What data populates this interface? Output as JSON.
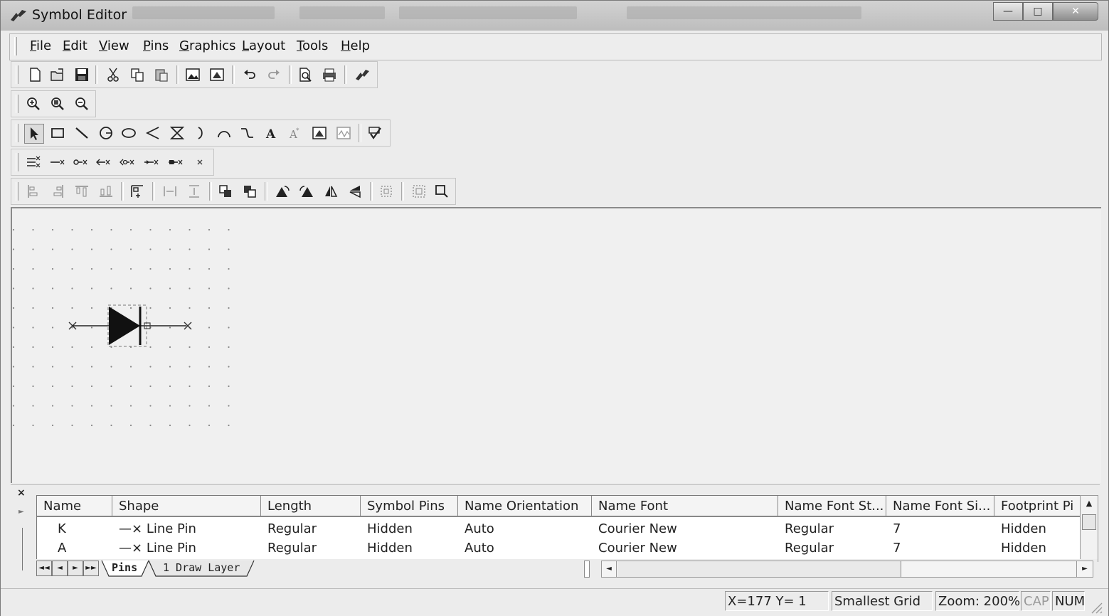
{
  "window": {
    "title": "Symbol Editor",
    "controls": [
      "minimize",
      "maximize",
      "close"
    ]
  },
  "menubar": {
    "items": [
      {
        "label": "File",
        "mnemonic": "F",
        "rest": "ile"
      },
      {
        "label": "Edit",
        "mnemonic": "E",
        "rest": "dit"
      },
      {
        "label": "View",
        "mnemonic": "V",
        "rest": "iew"
      },
      {
        "label": "Pins",
        "mnemonic": "P",
        "rest": "ins"
      },
      {
        "label": "Graphics",
        "mnemonic": "G",
        "rest": "raphics"
      },
      {
        "label": "Layout",
        "mnemonic": "L",
        "rest": "ayout"
      },
      {
        "label": "Tools",
        "mnemonic": "T",
        "rest": "ools"
      },
      {
        "label": "Help",
        "mnemonic": "H",
        "rest": "elp"
      }
    ]
  },
  "toolbars": {
    "standard": [
      "new-icon",
      "open-icon",
      "save-icon",
      "cut-icon",
      "copy-icon",
      "paste-icon",
      "import-image-icon",
      "symbol-properties-icon",
      "undo-icon",
      "redo-icon",
      "print-preview-icon",
      "print-icon",
      "wizard-icon"
    ],
    "zoom": [
      "zoom-in-icon",
      "zoom-window-icon",
      "zoom-out-icon"
    ],
    "graphics": [
      "select-icon",
      "rectangle-icon",
      "line-icon",
      "circle-icon",
      "ellipse-icon",
      "polyline-icon",
      "polygon-icon",
      "arc-icon",
      "semicircle-icon",
      "bezier-icon",
      "text-icon",
      "text-style-icon",
      "image-icon",
      "waveform-icon",
      "check-icon"
    ],
    "pins": [
      "pin-array-icon",
      "line-pin-icon",
      "dot-pin-icon",
      "clock-pin-icon",
      "dot-clock-pin-icon",
      "input-pin-icon",
      "output-pin-icon",
      "no-connect-icon"
    ],
    "layout": [
      "align-left-icon",
      "align-right-icon",
      "align-top-icon",
      "align-bottom-icon",
      "align-grid-icon",
      "space-horizontal-icon",
      "space-vertical-icon",
      "bring-front-icon",
      "send-back-icon",
      "rotate-left-icon",
      "rotate-right-icon",
      "flip-horizontal-icon",
      "flip-vertical-icon",
      "group-icon",
      "ungroup-icon",
      "fit-icon"
    ]
  },
  "pins_table": {
    "columns": [
      "Name",
      "Shape",
      "Length",
      "Symbol Pins",
      "Name Orientation",
      "Name Font",
      "Name Font St...",
      "Name Font Si...",
      "Footprint Pi"
    ],
    "rows": [
      {
        "name": "K",
        "shape": "Line Pin",
        "length": "Regular",
        "symbol_pins": "Hidden",
        "name_orientation": "Auto",
        "name_font": "Courier New",
        "name_font_style": "Regular",
        "name_font_size": "7",
        "footprint_pin": "Hidden"
      },
      {
        "name": "A",
        "shape": "Line Pin",
        "length": "Regular",
        "symbol_pins": "Hidden",
        "name_orientation": "Auto",
        "name_font": "Courier New",
        "name_font_style": "Regular",
        "name_font_size": "7",
        "footprint_pin": "Hidden"
      }
    ]
  },
  "sheet_tabs": [
    "Pins",
    "1 Draw Layer"
  ],
  "active_tab": "Pins",
  "panel_close": "×",
  "status": {
    "coords": "X=177 Y=  1",
    "grid": "Smallest Grid",
    "zoom": "Zoom: 200%",
    "cap": "CAP",
    "num": "NUM"
  }
}
